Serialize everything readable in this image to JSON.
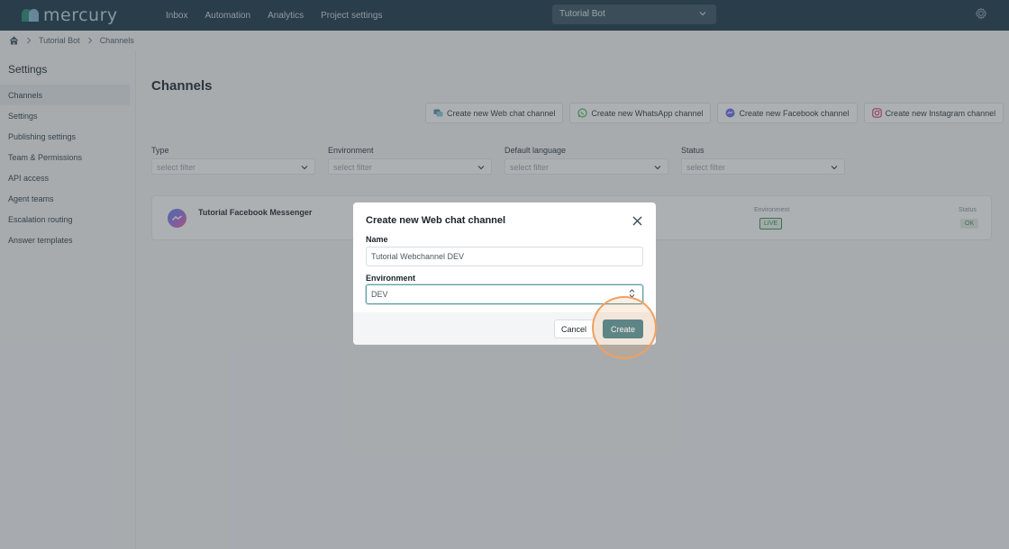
{
  "app": {
    "logo_text": "mercury",
    "logo_colors": [
      "#2e8b7a",
      "#8fc8e0"
    ]
  },
  "nav": {
    "items": [
      "Inbox",
      "Automation",
      "Analytics",
      "Project settings"
    ],
    "bot_select": "Tutorial Bot"
  },
  "breadcrumb": {
    "items": [
      "Tutorial Bot",
      "Channels"
    ]
  },
  "sidebar": {
    "title": "Settings",
    "items": [
      {
        "label": "Channels",
        "active": true
      },
      {
        "label": "Settings"
      },
      {
        "label": "Publishing settings"
      },
      {
        "label": "Team & Permissions"
      },
      {
        "label": "API access"
      },
      {
        "label": "Agent teams"
      },
      {
        "label": "Escalation routing"
      },
      {
        "label": "Answer templates"
      }
    ]
  },
  "main": {
    "title": "Channels",
    "create_buttons": [
      {
        "label": "Create new Web chat channel",
        "icon": "webchat-icon",
        "color": "#5a8fa8"
      },
      {
        "label": "Create new WhatsApp channel",
        "icon": "whatsapp-icon",
        "color": "#3fbf5a"
      },
      {
        "label": "Create new Facebook channel",
        "icon": "messenger-icon",
        "color": "#6a6ef0"
      },
      {
        "label": "Create new Instagram channel",
        "icon": "instagram-icon",
        "color": "#d8407a"
      }
    ],
    "filters": [
      {
        "label": "Type",
        "placeholder": "select filter"
      },
      {
        "label": "Environment",
        "placeholder": "select filter"
      },
      {
        "label": "Default language",
        "placeholder": "select filter"
      },
      {
        "label": "Status",
        "placeholder": "select filter"
      }
    ],
    "channel_card": {
      "name": "Tutorial Facebook Messenger",
      "environment_label": "Environment",
      "environment_value": "LIVE",
      "status_label": "Status",
      "status_value": "OK"
    }
  },
  "modal": {
    "title": "Create new Web chat channel",
    "name_label": "Name",
    "name_value": "Tutorial Webchannel DEV",
    "environment_label": "Environment",
    "environment_value": "DEV",
    "cancel_label": "Cancel",
    "create_label": "Create",
    "accent_color": "#3d7f8f"
  }
}
